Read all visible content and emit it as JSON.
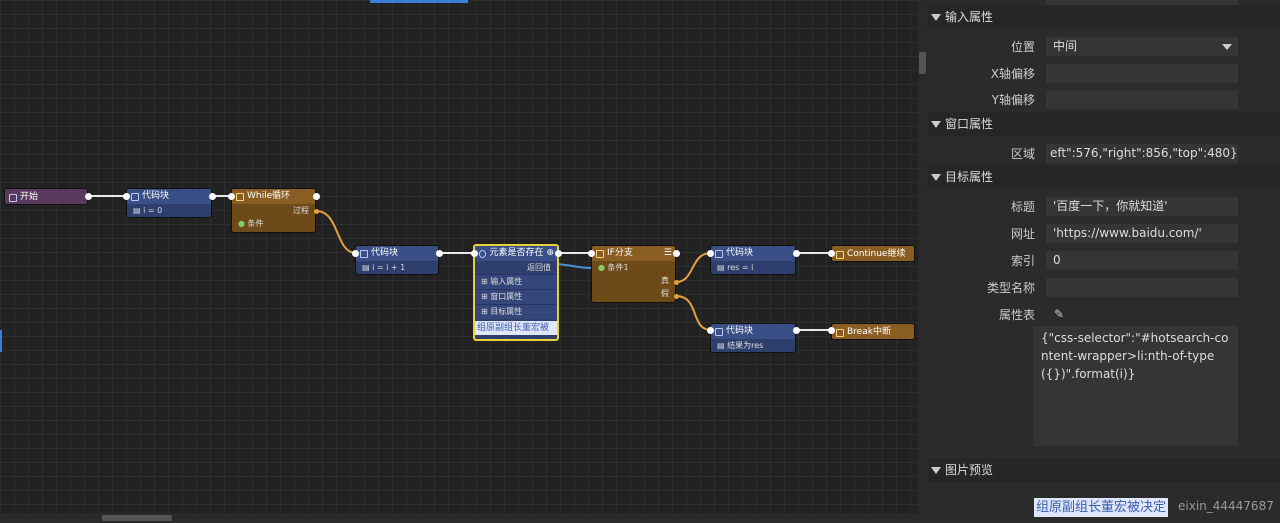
{
  "nodes": {
    "start": {
      "title": "开始"
    },
    "code1": {
      "title": "代码块",
      "line": "i = 0"
    },
    "while": {
      "title": "While循环",
      "out_label": "过程",
      "cond_label": "条件"
    },
    "code2": {
      "title": "代码块",
      "line": "i = i + 1"
    },
    "exists": {
      "title": "元素是否存在",
      "ret_label": "返回值",
      "rows": [
        "输入属性",
        "窗口属性",
        "目标属性"
      ],
      "image_text": "组原副组长董宏被"
    },
    "ifbranch": {
      "title": "IF分支",
      "cond_label": "条件1",
      "true_label": "真",
      "false_label": "假"
    },
    "code3": {
      "title": "代码块",
      "line": "res = i"
    },
    "code4": {
      "title": "代码块",
      "line": "结果为res"
    },
    "continue": {
      "title": "Continue继续"
    },
    "break": {
      "title": "Break中断"
    }
  },
  "panel": {
    "sections": {
      "input": "输入属性",
      "window": "窗口属性",
      "target": "目标属性",
      "preview": "图片预览"
    },
    "fields": {
      "position_label": "位置",
      "position_value": "中间",
      "xoffset_label": "X轴偏移",
      "xoffset_value": "",
      "yoffset_label": "Y轴偏移",
      "yoffset_value": "",
      "region_label": "区域",
      "region_value": "eft\":576,\"right\":856,\"top\":480}",
      "title_label": "标题",
      "title_value": "'百度一下，你就知道'",
      "url_label": "网址",
      "url_value": "'https://www.baidu.com/'",
      "index_label": "索引",
      "index_value": "0",
      "typename_label": "类型名称",
      "typename_value": "",
      "attrs_label": "属性表",
      "attrs_value": "{\"css-selector\":\"#hotsearch-content-wrapper>li:nth-of-type({})\".format(i)}"
    },
    "preview_text": "组原副组长董宏被决定",
    "watermark": "eixin_44447687"
  }
}
